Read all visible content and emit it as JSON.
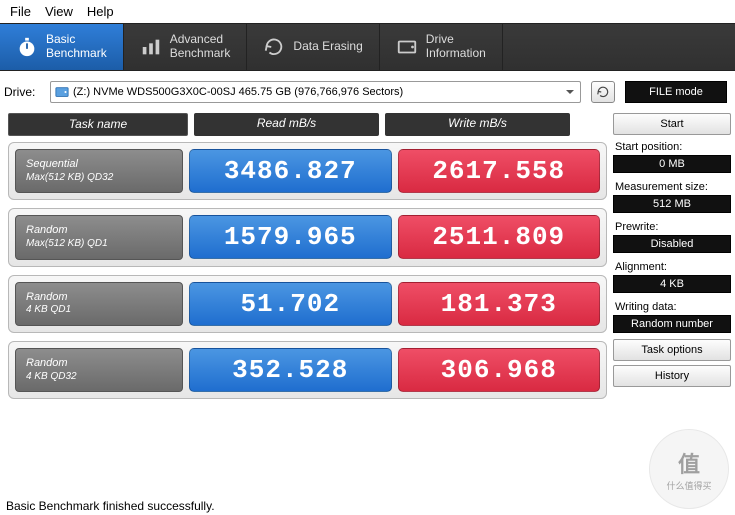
{
  "menu": {
    "file": "File",
    "view": "View",
    "help": "Help"
  },
  "tabs": {
    "basic": "Basic\nBenchmark",
    "advanced": "Advanced\nBenchmark",
    "erase": "Data Erasing",
    "drive": "Drive\nInformation"
  },
  "drive": {
    "label": "Drive:",
    "selected": "(Z:) NVMe WDS500G3X0C-00SJ   465.75 GB  (976,766,976 Sectors)",
    "file_mode": "FILE mode"
  },
  "headers": {
    "task": "Task name",
    "read": "Read mB/s",
    "write": "Write mB/s"
  },
  "rows": [
    {
      "t1": "Sequential",
      "t2": "Max(512 KB) QD32",
      "read": "3486.827",
      "write": "2617.558"
    },
    {
      "t1": "Random",
      "t2": "Max(512 KB) QD1",
      "read": "1579.965",
      "write": "2511.809"
    },
    {
      "t1": "Random",
      "t2": "4 KB QD1",
      "read": "51.702",
      "write": "181.373"
    },
    {
      "t1": "Random",
      "t2": "4 KB QD32",
      "read": "352.528",
      "write": "306.968"
    }
  ],
  "side": {
    "start": "Start",
    "start_pos_lab": "Start position:",
    "start_pos_val": "0 MB",
    "meas_lab": "Measurement size:",
    "meas_val": "512 MB",
    "prewrite_lab": "Prewrite:",
    "prewrite_val": "Disabled",
    "align_lab": "Alignment:",
    "align_val": "4 KB",
    "wdata_lab": "Writing data:",
    "wdata_val": "Random number",
    "task_options": "Task options",
    "history": "History"
  },
  "status": "Basic Benchmark finished successfully.",
  "watermark": {
    "big": "值",
    "small": "什么值得买"
  }
}
